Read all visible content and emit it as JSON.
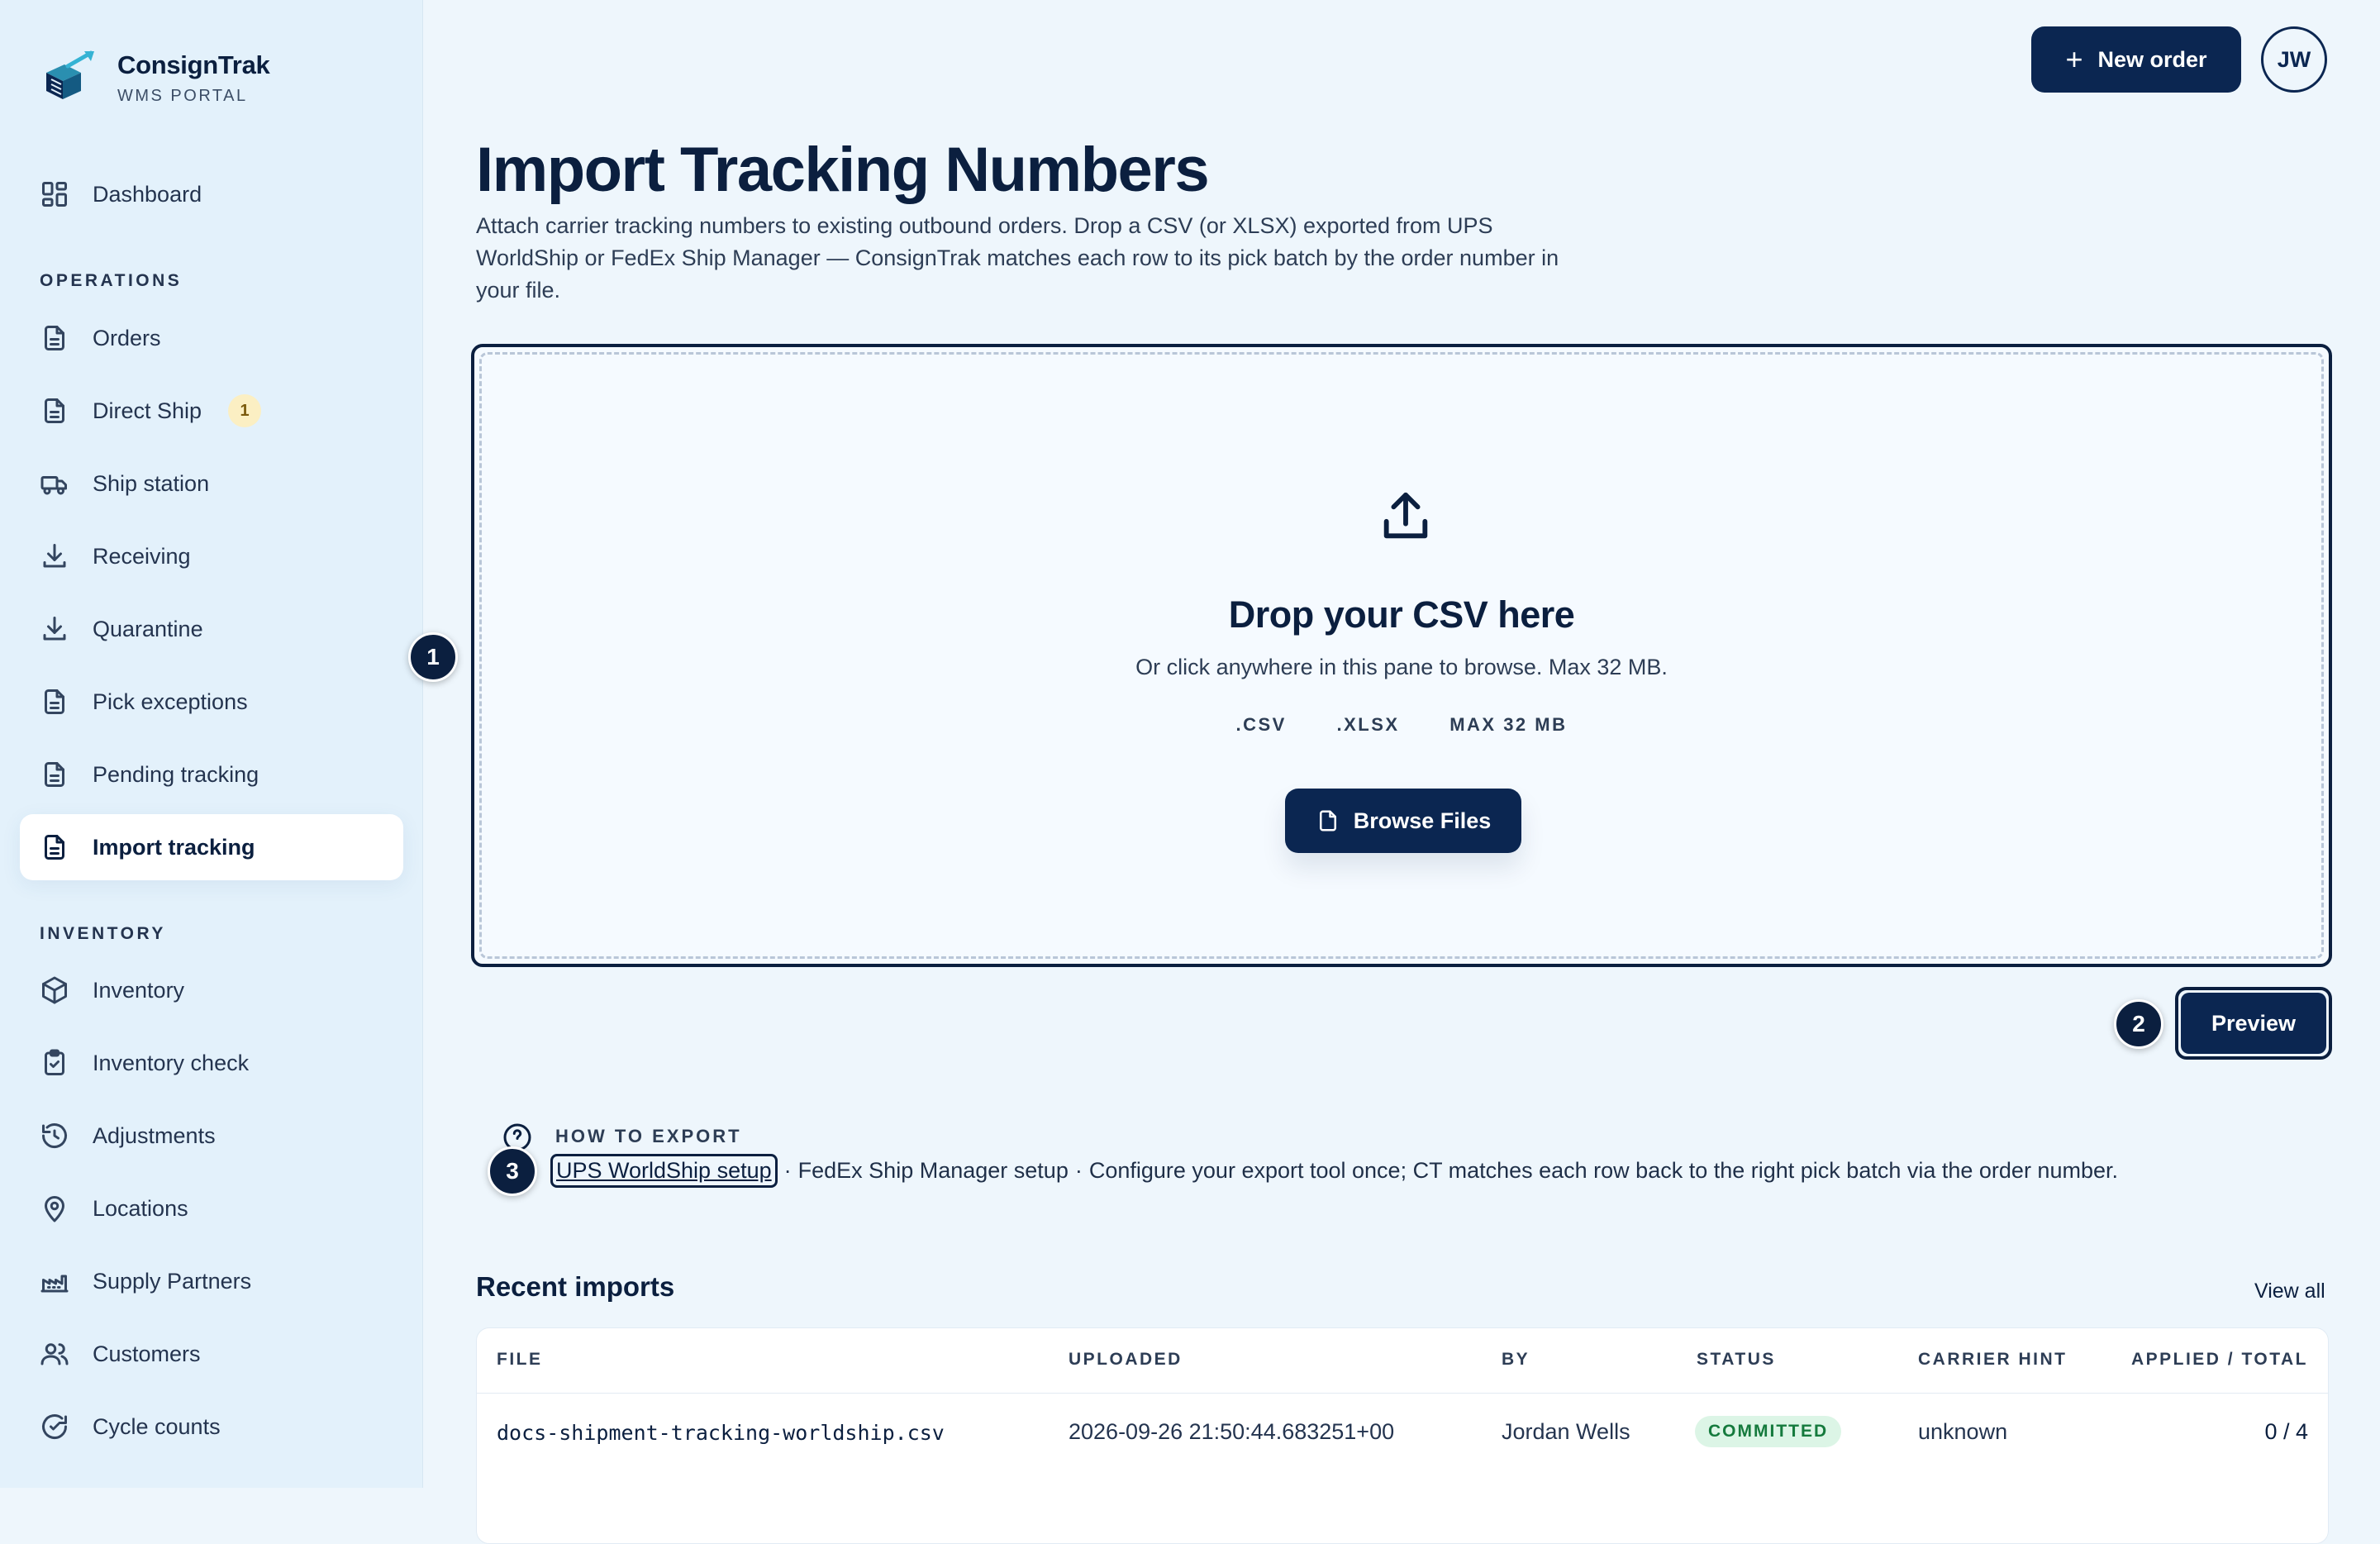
{
  "brand": {
    "name": "ConsignTrak",
    "subtitle": "WMS PORTAL"
  },
  "sidebar": {
    "dashboard": "Dashboard",
    "sections": {
      "operations": "OPERATIONS",
      "inventory": "INVENTORY"
    },
    "items": [
      {
        "label": "Dashboard",
        "icon": "grid-icon"
      },
      {
        "label": "Orders",
        "icon": "document-icon"
      },
      {
        "label": "Direct Ship",
        "icon": "document-icon",
        "badge": "1"
      },
      {
        "label": "Ship station",
        "icon": "truck-icon"
      },
      {
        "label": "Receiving",
        "icon": "download-icon"
      },
      {
        "label": "Quarantine",
        "icon": "download-icon"
      },
      {
        "label": "Pick exceptions",
        "icon": "document-icon"
      },
      {
        "label": "Pending tracking",
        "icon": "document-icon"
      },
      {
        "label": "Import tracking",
        "icon": "document-icon",
        "active": true
      },
      {
        "label": "Inventory",
        "icon": "box-icon"
      },
      {
        "label": "Inventory check",
        "icon": "clipboard-check-icon"
      },
      {
        "label": "Adjustments",
        "icon": "history-icon"
      },
      {
        "label": "Locations",
        "icon": "map-pin-icon"
      },
      {
        "label": "Supply Partners",
        "icon": "factory-icon"
      },
      {
        "label": "Customers",
        "icon": "users-icon"
      },
      {
        "label": "Cycle counts",
        "icon": "refresh-check-icon"
      }
    ]
  },
  "header": {
    "new_order_label": "New order",
    "avatar_initials": "JW"
  },
  "page": {
    "title": "Import Tracking Numbers",
    "description": "Attach carrier tracking numbers to existing outbound orders. Drop a CSV (or XLSX) exported from UPS WorldShip or FedEx Ship Manager — ConsignTrak matches each row to its pick batch by the order number in your file."
  },
  "dropzone": {
    "title": "Drop your CSV here",
    "hint": "Or click anywhere in this pane to browse. Max 32 MB.",
    "formats": [
      ".CSV",
      ".XLSX",
      "MAX 32 MB"
    ],
    "browse_label": "Browse Files"
  },
  "steps": {
    "one": "1",
    "two": "2",
    "three": "3"
  },
  "preview_label": "Preview",
  "howto": {
    "label": "HOW TO EXPORT",
    "ups_link": "UPS WorldShip setup",
    "separator": "·",
    "fedex_link": "FedEx Ship Manager setup",
    "text": "Configure your export tool once; CT matches each row back to the right pick batch via the order number."
  },
  "recent_imports": {
    "title": "Recent imports",
    "view_all": "View all",
    "columns": [
      "FILE",
      "UPLOADED",
      "BY",
      "STATUS",
      "CARRIER HINT",
      "APPLIED / TOTAL"
    ],
    "rows": [
      {
        "file": "docs-shipment-tracking-worldship.csv",
        "uploaded": "2026-09-26 21:50:44.683251+00",
        "by": "Jordan Wells",
        "status": "COMMITTED",
        "carrier_hint": "unknown",
        "applied_total": "0 / 4"
      }
    ]
  },
  "colors": {
    "primary": "#0b2651",
    "background": "#eef6fc",
    "sidebar": "#e3f1fb",
    "status_committed": "#157a3d"
  }
}
